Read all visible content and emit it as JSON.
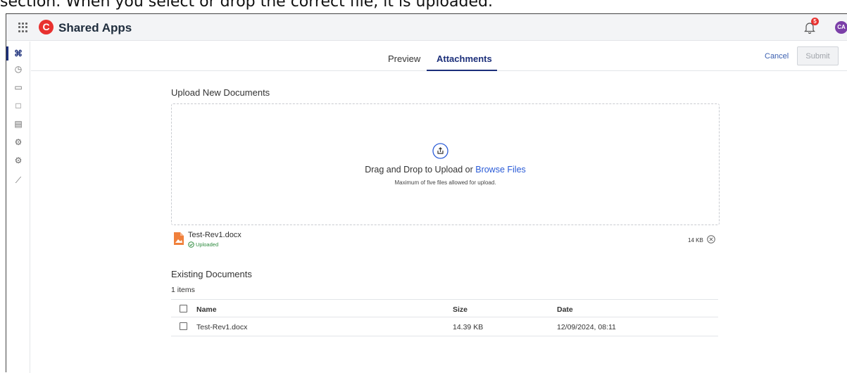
{
  "caption": "section. When you select or drop the correct file, it is uploaded.",
  "header": {
    "app_title": "Shared Apps",
    "logo_letter": "C",
    "notification_count": "5",
    "avatar_initials": "CA"
  },
  "sidebar": {
    "items": [
      {
        "icon": "command-icon",
        "glyph": "⌘"
      },
      {
        "icon": "clock-icon",
        "glyph": "◷"
      },
      {
        "icon": "folder-icon",
        "glyph": "▭"
      },
      {
        "icon": "briefcase-icon",
        "glyph": "□"
      },
      {
        "icon": "id-card-icon",
        "glyph": "▤"
      },
      {
        "icon": "gear-icon",
        "glyph": "⚙"
      },
      {
        "icon": "gear-icon",
        "glyph": "⚙"
      },
      {
        "icon": "chart-line-icon",
        "glyph": "⟋"
      }
    ]
  },
  "tabs": {
    "preview": "Preview",
    "attachments": "Attachments"
  },
  "actions": {
    "cancel": "Cancel",
    "submit": "Submit"
  },
  "upload": {
    "title": "Upload New Documents",
    "drag_text": "Drag and Drop to Upload or ",
    "browse_link": "Browse Files",
    "limit_note": "Maximum of five files allowed for upload."
  },
  "uploaded_file": {
    "name": "Test-Rev1.docx",
    "status": "Uploaded",
    "size": "14 KB"
  },
  "existing": {
    "title": "Existing Documents",
    "count": "1 items",
    "columns": {
      "name": "Name",
      "size": "Size",
      "date": "Date"
    },
    "rows": [
      {
        "name": "Test-Rev1.docx",
        "size": "14.39 KB",
        "date": "12/09/2024, 08:11"
      }
    ]
  },
  "colors": {
    "brand_red": "#e8312f",
    "accent_navy": "#1c2f7a",
    "link_blue": "#2a5bd7",
    "success_green": "#2e8b3e"
  }
}
